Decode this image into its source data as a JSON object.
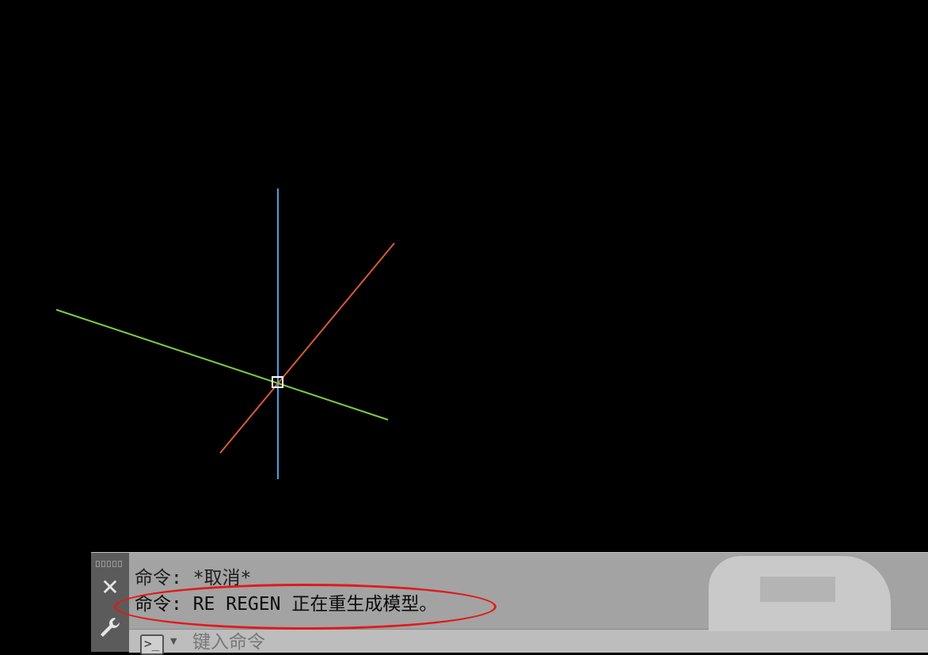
{
  "command_line": {
    "history": [
      "命令: *取消*",
      "命令: RE REGEN 正在重生成模型。"
    ],
    "input_placeholder": "键入命令",
    "close_glyph": "✕"
  },
  "drawing": {
    "colors": {
      "blue_line": "#4a9fe0",
      "orange_line": "#d85a3a",
      "green_line": "#7ecb3f",
      "cursor_box": "#ffffff",
      "highlight": "#e01a1a"
    }
  }
}
